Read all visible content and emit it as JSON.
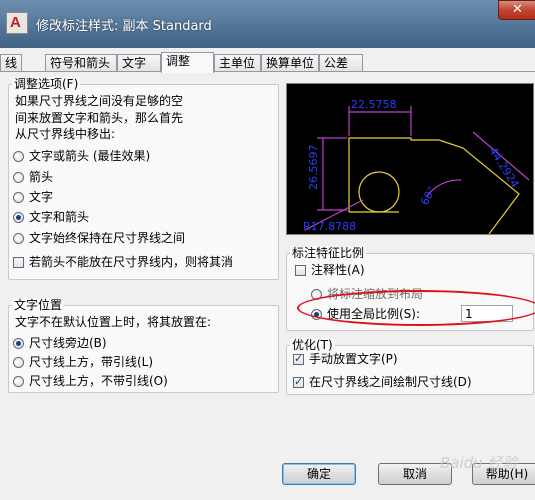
{
  "window": {
    "title": "修改标注样式: 副本 Standard"
  },
  "tabs": [
    {
      "label": "线"
    },
    {
      "label": "符号和箭头"
    },
    {
      "label": "文字"
    },
    {
      "label": "调整"
    },
    {
      "label": "主单位"
    },
    {
      "label": "换算单位"
    },
    {
      "label": "公差"
    }
  ],
  "fit_options": {
    "title": "调整选项(F)",
    "description": [
      "如果尺寸界线之间没有足够的空",
      "间来放置文字和箭头，那么首先",
      "从尺寸界线中移出:"
    ],
    "options": [
      {
        "label": "文字或箭头 (最佳效果)",
        "selected": false
      },
      {
        "label": "箭头",
        "selected": false
      },
      {
        "label": "文字",
        "selected": false
      },
      {
        "label": "文字和箭头",
        "selected": true
      },
      {
        "label": "文字始终保持在尺寸界线之间",
        "selected": false
      }
    ],
    "suppress_arrows": {
      "label": "若箭头不能放在尺寸界线内，则将其消",
      "checked": false
    }
  },
  "text_placement": {
    "title": "文字位置",
    "description": "文字不在默认位置上时，将其放置在:",
    "options": [
      {
        "label": "尺寸线旁边(B)",
        "selected": true
      },
      {
        "label": "尺寸线上方，带引线(L)",
        "selected": false
      },
      {
        "label": "尺寸线上方，不带引线(O)",
        "selected": false
      }
    ]
  },
  "preview": {
    "labels": {
      "top": "22.5758",
      "left": "26.5697",
      "right": "44.2924",
      "angle": "60°",
      "radius": "R17.8788"
    },
    "colors": {
      "background": "#000000",
      "dim": "#c040d0",
      "geometry": "#e8d232",
      "text": "#2b3cff"
    }
  },
  "scale": {
    "title": "标注特征比例",
    "annotative": {
      "label": "注释性(A)",
      "checked": false
    },
    "options": [
      {
        "label": "将标注缩放到布局",
        "selected": false
      },
      {
        "label": "使用全局比例(S):",
        "selected": true
      }
    ],
    "global_value": "1"
  },
  "fine_tuning": {
    "title": "优化(T)",
    "options": [
      {
        "label": "手动放置文字(P)",
        "checked": true
      },
      {
        "label": "在尺寸界线之间绘制尺寸线(D)",
        "checked": true
      }
    ]
  },
  "buttons": {
    "ok": "确定",
    "cancel": "取消",
    "help": "帮助(H)"
  },
  "watermark": "Baidu 经验"
}
